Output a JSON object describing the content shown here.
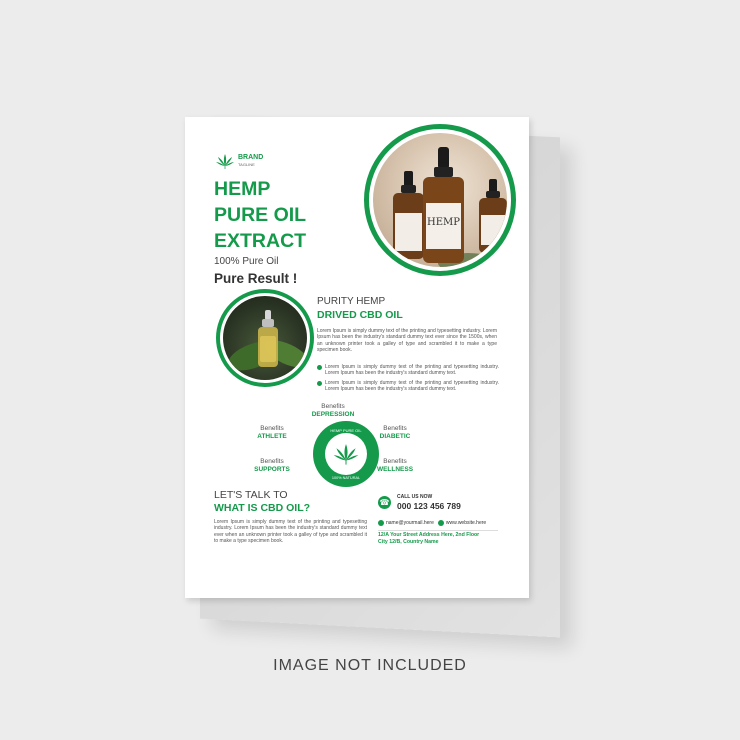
{
  "brand": {
    "name": "BRAND",
    "tagline": "TAGLINE"
  },
  "headline": {
    "line1": "HEMP",
    "line2": "PURE OIL",
    "line3": "EXTRACT"
  },
  "subheading": {
    "line1": "100% Pure Oil",
    "line2": "Pure Result !"
  },
  "purity": {
    "title1": "PURITY HEMP",
    "title2": "DRIVED CBD OIL",
    "body": "Lorem Ipsum is simply dummy text of the printing and typesetting industry. Lorem Ipsum has been the industry's standard dummy text ever since the 1500s, when an unknown printer took a galley of type and scrambled it to make a type specimen book.",
    "bullets": [
      "Lorem Ipsum is simply dummy text of the printing and typesetting industry. Lorem Ipsum has been the industry's standard dummy text.",
      "Lorem Ipsum is simply dummy text of the printing and typesetting industry. Lorem Ipsum has been the industry's standard dummy text."
    ]
  },
  "benefits": [
    {
      "label": "Benefits",
      "value": "DEPRESSION"
    },
    {
      "label": "Benefits",
      "value": "ATHLETE"
    },
    {
      "label": "Benefits",
      "value": "DIABETIC"
    },
    {
      "label": "Benefits",
      "value": "SUPPORTS"
    },
    {
      "label": "Benefits",
      "value": "WELLNESS"
    }
  ],
  "badge": {
    "top": "HEMP PURE OIL",
    "bottom": "100% NATURAL"
  },
  "talk": {
    "line1": "LET'S TALK TO",
    "line2": "WHAT IS CBD OIL?",
    "body": "Lorem Ipsum is simply dummy text of the printing and typesetting industry. Lorem Ipsum has been the industry's standard dummy text ever  when an unknown printer took a galley of type and scrambled it to make a type specimen book."
  },
  "contact": {
    "call_label": "CALL US NOW",
    "phone": "000 123 456 789",
    "email": "name@yourmail.here",
    "website": "www.website.here",
    "address_line1": "12/A Your Street Address Here, 2nd Floor",
    "address_line2": "City 12/B, Country Name"
  },
  "bottle_label": "HEMP",
  "caption": "IMAGE NOT INCLUDED",
  "colors": {
    "accent": "#159a4b",
    "background": "#ececec",
    "page": "#ffffff"
  }
}
